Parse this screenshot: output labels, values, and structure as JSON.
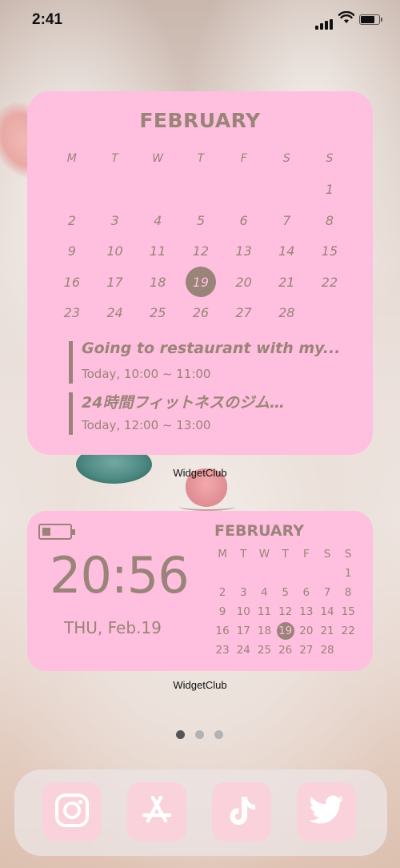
{
  "status_bar": {
    "time": "2:41"
  },
  "widget_large": {
    "month": "FEBRUARY",
    "weekdays": [
      "M",
      "T",
      "W",
      "T",
      "F",
      "S",
      "S"
    ],
    "weeks": [
      [
        "",
        "",
        "",
        "",
        "",
        "",
        "1"
      ],
      [
        "2",
        "3",
        "4",
        "5",
        "6",
        "7",
        "8"
      ],
      [
        "9",
        "10",
        "11",
        "12",
        "13",
        "14",
        "15"
      ],
      [
        "16",
        "17",
        "18",
        "19",
        "20",
        "21",
        "22"
      ],
      [
        "23",
        "24",
        "25",
        "26",
        "27",
        "28",
        ""
      ]
    ],
    "today": "19",
    "events": [
      {
        "title": "Going to restaurant with my...",
        "time": "Today, 10:00 ~ 11:00"
      },
      {
        "title": "24時間フィットネスのジム…",
        "time": "Today, 12:00 ~ 13:00"
      }
    ],
    "caption": "WidgetClub"
  },
  "widget_small": {
    "battery_level": 0.3,
    "clock": "20:56",
    "date": "THU, Feb.19",
    "month": "FEBRUARY",
    "weekdays": [
      "M",
      "T",
      "W",
      "T",
      "F",
      "S",
      "S"
    ],
    "weeks": [
      [
        "",
        "",
        "",
        "",
        "",
        "",
        "1"
      ],
      [
        "2",
        "3",
        "4",
        "5",
        "6",
        "7",
        "8"
      ],
      [
        "9",
        "10",
        "11",
        "12",
        "13",
        "14",
        "15"
      ],
      [
        "16",
        "17",
        "18",
        "19",
        "20",
        "21",
        "22"
      ],
      [
        "23",
        "24",
        "25",
        "26",
        "27",
        "28",
        ""
      ]
    ],
    "today": "19",
    "caption": "WidgetClub"
  },
  "page_indicator": {
    "pages": 3,
    "current": 1
  },
  "dock": {
    "apps": [
      {
        "name": "instagram",
        "icon": "instagram-icon"
      },
      {
        "name": "app-store",
        "icon": "app-store-icon"
      },
      {
        "name": "tiktok",
        "icon": "tiktok-icon"
      },
      {
        "name": "twitter",
        "icon": "twitter-icon"
      }
    ]
  },
  "colors": {
    "widget_bg": "#ffbfde",
    "widget_text": "#9a8379",
    "dock_icon_bg": "#fad2db"
  }
}
